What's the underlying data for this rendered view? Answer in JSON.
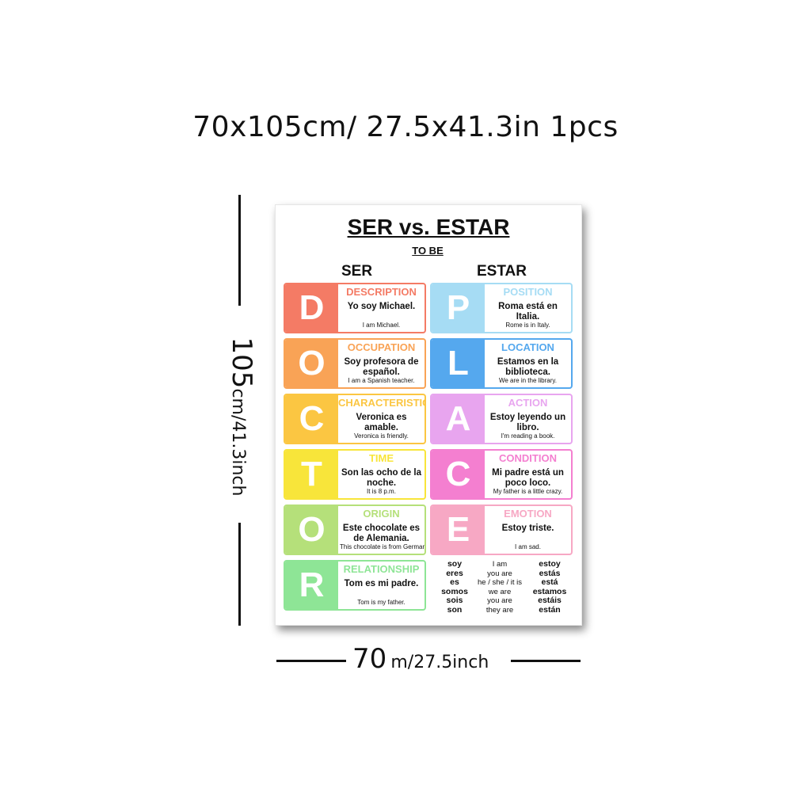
{
  "header": {
    "size_text": "70x105cm/ 27.5x41.3in 1pcs"
  },
  "dimensions": {
    "height_big": "105",
    "height_small": "cm/41.3inch",
    "width_big": "70",
    "width_small": "m/27.5inch"
  },
  "poster": {
    "title": "SER vs. ESTAR",
    "subtitle": "TO BE",
    "ser_heading": "SER",
    "estar_heading": "ESTAR",
    "ser_cards": [
      {
        "letter": "D",
        "label": "DESCRIPTION",
        "sentence": "Yo soy Michael.",
        "translation": "I am Michael.",
        "color": "#f47b65"
      },
      {
        "letter": "O",
        "label": "OCCUPATION",
        "sentence": "Soy profesora de español.",
        "translation": "I am a Spanish teacher.",
        "color": "#f9a356"
      },
      {
        "letter": "C",
        "label": "CHARACTERISTIC",
        "sentence": "Veronica es amable.",
        "translation": "Veronica is friendly.",
        "color": "#fbc642"
      },
      {
        "letter": "T",
        "label": "TIME",
        "sentence": "Son las ocho de la noche.",
        "translation": "It is 8 p.m.",
        "color": "#f8e53a"
      },
      {
        "letter": "O",
        "label": "ORIGIN",
        "sentence": "Este chocolate es de Alemania.",
        "translation": "This chocolate is from Germany.",
        "color": "#b5e07a"
      },
      {
        "letter": "R",
        "label": "RELATIONSHIP",
        "sentence": "Tom es mi padre.",
        "translation": "Tom is my father.",
        "color": "#8ee596"
      }
    ],
    "estar_cards": [
      {
        "letter": "P",
        "label": "POSITION",
        "sentence": "Roma está en Italia.",
        "translation": "Rome is in Italy.",
        "color": "#a6dcf4"
      },
      {
        "letter": "L",
        "label": "LOCATION",
        "sentence": "Estamos en la biblioteca.",
        "translation": "We are in the library.",
        "color": "#55a8ee"
      },
      {
        "letter": "A",
        "label": "ACTION",
        "sentence": "Estoy leyendo un libro.",
        "translation": "I'm reading a book.",
        "color": "#e8a5ef"
      },
      {
        "letter": "C",
        "label": "CONDITION",
        "sentence": "Mi padre está un poco loco.",
        "translation": "My father is a little crazy.",
        "color": "#f47fd0"
      },
      {
        "letter": "E",
        "label": "EMOTION",
        "sentence": "Estoy triste.",
        "translation": "I am sad.",
        "color": "#f7a8c4"
      }
    ],
    "conjugation": {
      "ser": [
        "soy",
        "eres",
        "es",
        "somos",
        "sois",
        "son"
      ],
      "english": [
        "I am",
        "you are",
        "he / she / it is",
        "we are",
        "you are",
        "they are"
      ],
      "estar": [
        "estoy",
        "estás",
        "está",
        "estamos",
        "estáis",
        "están"
      ]
    }
  }
}
